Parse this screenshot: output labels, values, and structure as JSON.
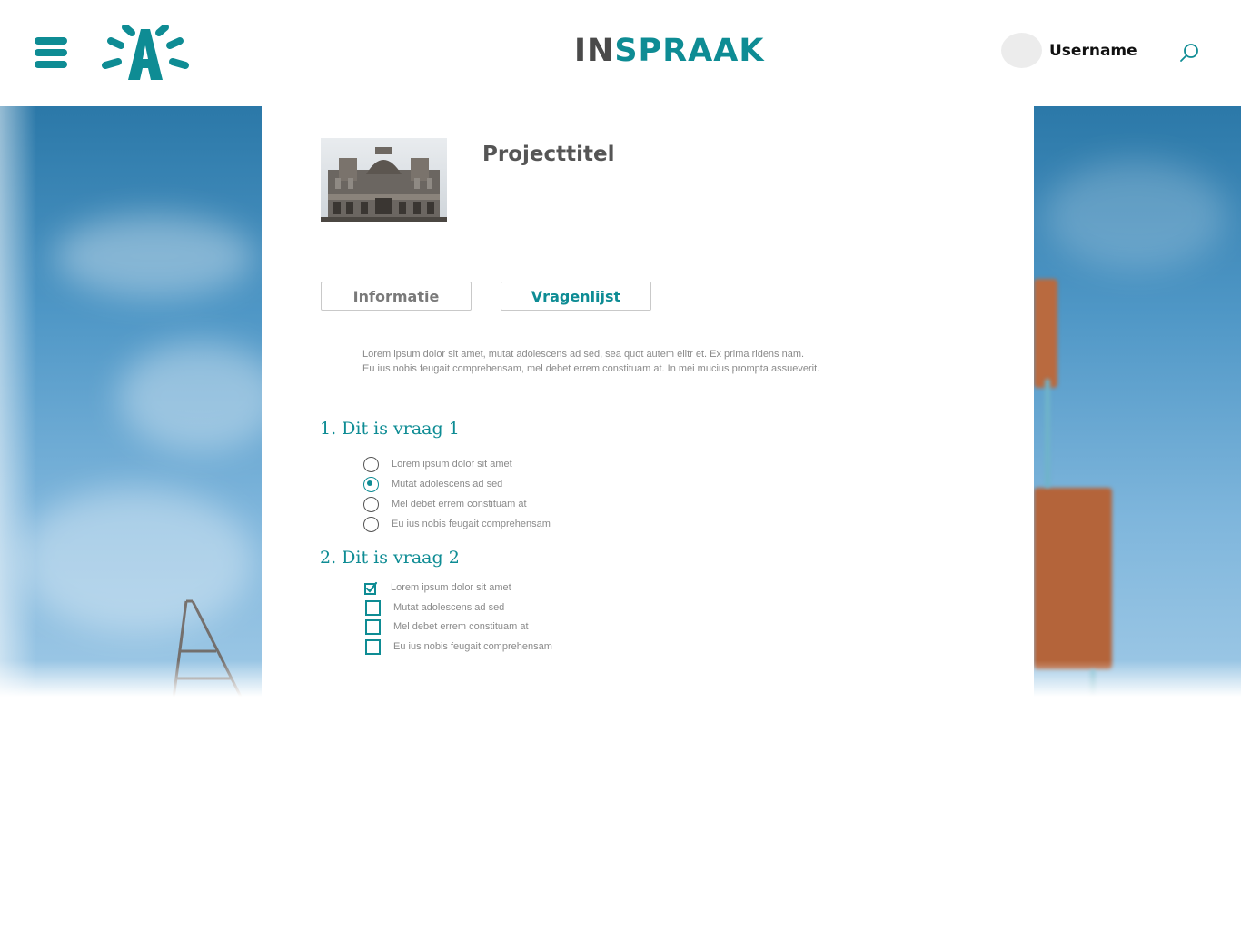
{
  "header": {
    "brand_in": "IN",
    "brand_spraak": "SPRAAK",
    "username": "Username"
  },
  "project": {
    "title": "Projecttitel"
  },
  "tabs": [
    {
      "label": "Informatie",
      "active": false
    },
    {
      "label": "Vragenlijst",
      "active": true
    }
  ],
  "intro": {
    "line1": "Lorem ipsum dolor sit amet, mutat adolescens ad sed, sea quot autem elitr et. Ex prima ridens nam.",
    "line2": "Eu ius nobis feugait comprehensam, mel debet errem constituam at. In mei mucius prompta assueverit."
  },
  "questions": [
    {
      "title": "1. Dit is vraag 1",
      "type": "radio",
      "options": [
        {
          "label": "Lorem ipsum dolor sit amet",
          "checked": false
        },
        {
          "label": "Mutat adolescens ad sed",
          "checked": true
        },
        {
          "label": "Mel debet errem constituam at",
          "checked": false
        },
        {
          "label": "Eu ius nobis feugait comprehensam",
          "checked": false
        }
      ]
    },
    {
      "title": "2. Dit is vraag 2",
      "type": "checkbox",
      "options": [
        {
          "label": "Lorem ipsum dolor sit amet",
          "checked": true
        },
        {
          "label": "Mutat adolescens ad sed",
          "checked": false
        },
        {
          "label": "Mel debet errem constituam at",
          "checked": false
        },
        {
          "label": "Eu ius nobis feugait comprehensam",
          "checked": false
        }
      ]
    }
  ],
  "colors": {
    "accent": "#0e8c94",
    "text_dark": "#555555",
    "text_muted": "#8a8a8a"
  },
  "icons": {
    "menu": "hamburger-icon",
    "logo": "city-logo-icon",
    "search": "search-icon",
    "radio_checked": "radio-checked-icon",
    "radio_unchecked": "radio-unchecked-icon",
    "checkbox_checked": "checkbox-checked-icon",
    "checkbox_unchecked": "checkbox-unchecked-icon"
  }
}
